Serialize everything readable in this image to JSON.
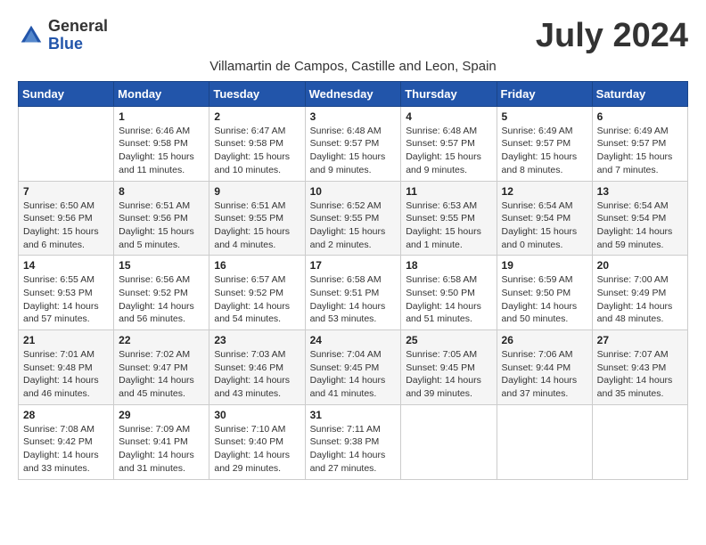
{
  "logo": {
    "general": "General",
    "blue": "Blue"
  },
  "title": "July 2024",
  "location": "Villamartin de Campos, Castille and Leon, Spain",
  "headers": [
    "Sunday",
    "Monday",
    "Tuesday",
    "Wednesday",
    "Thursday",
    "Friday",
    "Saturday"
  ],
  "weeks": [
    [
      null,
      {
        "day": "1",
        "sunrise": "6:46 AM",
        "sunset": "9:58 PM",
        "daylight": "15 hours and 11 minutes."
      },
      {
        "day": "2",
        "sunrise": "6:47 AM",
        "sunset": "9:58 PM",
        "daylight": "15 hours and 10 minutes."
      },
      {
        "day": "3",
        "sunrise": "6:48 AM",
        "sunset": "9:57 PM",
        "daylight": "15 hours and 9 minutes."
      },
      {
        "day": "4",
        "sunrise": "6:48 AM",
        "sunset": "9:57 PM",
        "daylight": "15 hours and 9 minutes."
      },
      {
        "day": "5",
        "sunrise": "6:49 AM",
        "sunset": "9:57 PM",
        "daylight": "15 hours and 8 minutes."
      },
      {
        "day": "6",
        "sunrise": "6:49 AM",
        "sunset": "9:57 PM",
        "daylight": "15 hours and 7 minutes."
      }
    ],
    [
      {
        "day": "7",
        "sunrise": "6:50 AM",
        "sunset": "9:56 PM",
        "daylight": "15 hours and 6 minutes."
      },
      {
        "day": "8",
        "sunrise": "6:51 AM",
        "sunset": "9:56 PM",
        "daylight": "15 hours and 5 minutes."
      },
      {
        "day": "9",
        "sunrise": "6:51 AM",
        "sunset": "9:55 PM",
        "daylight": "15 hours and 4 minutes."
      },
      {
        "day": "10",
        "sunrise": "6:52 AM",
        "sunset": "9:55 PM",
        "daylight": "15 hours and 2 minutes."
      },
      {
        "day": "11",
        "sunrise": "6:53 AM",
        "sunset": "9:55 PM",
        "daylight": "15 hours and 1 minute."
      },
      {
        "day": "12",
        "sunrise": "6:54 AM",
        "sunset": "9:54 PM",
        "daylight": "15 hours and 0 minutes."
      },
      {
        "day": "13",
        "sunrise": "6:54 AM",
        "sunset": "9:54 PM",
        "daylight": "14 hours and 59 minutes."
      }
    ],
    [
      {
        "day": "14",
        "sunrise": "6:55 AM",
        "sunset": "9:53 PM",
        "daylight": "14 hours and 57 minutes."
      },
      {
        "day": "15",
        "sunrise": "6:56 AM",
        "sunset": "9:52 PM",
        "daylight": "14 hours and 56 minutes."
      },
      {
        "day": "16",
        "sunrise": "6:57 AM",
        "sunset": "9:52 PM",
        "daylight": "14 hours and 54 minutes."
      },
      {
        "day": "17",
        "sunrise": "6:58 AM",
        "sunset": "9:51 PM",
        "daylight": "14 hours and 53 minutes."
      },
      {
        "day": "18",
        "sunrise": "6:58 AM",
        "sunset": "9:50 PM",
        "daylight": "14 hours and 51 minutes."
      },
      {
        "day": "19",
        "sunrise": "6:59 AM",
        "sunset": "9:50 PM",
        "daylight": "14 hours and 50 minutes."
      },
      {
        "day": "20",
        "sunrise": "7:00 AM",
        "sunset": "9:49 PM",
        "daylight": "14 hours and 48 minutes."
      }
    ],
    [
      {
        "day": "21",
        "sunrise": "7:01 AM",
        "sunset": "9:48 PM",
        "daylight": "14 hours and 46 minutes."
      },
      {
        "day": "22",
        "sunrise": "7:02 AM",
        "sunset": "9:47 PM",
        "daylight": "14 hours and 45 minutes."
      },
      {
        "day": "23",
        "sunrise": "7:03 AM",
        "sunset": "9:46 PM",
        "daylight": "14 hours and 43 minutes."
      },
      {
        "day": "24",
        "sunrise": "7:04 AM",
        "sunset": "9:45 PM",
        "daylight": "14 hours and 41 minutes."
      },
      {
        "day": "25",
        "sunrise": "7:05 AM",
        "sunset": "9:45 PM",
        "daylight": "14 hours and 39 minutes."
      },
      {
        "day": "26",
        "sunrise": "7:06 AM",
        "sunset": "9:44 PM",
        "daylight": "14 hours and 37 minutes."
      },
      {
        "day": "27",
        "sunrise": "7:07 AM",
        "sunset": "9:43 PM",
        "daylight": "14 hours and 35 minutes."
      }
    ],
    [
      {
        "day": "28",
        "sunrise": "7:08 AM",
        "sunset": "9:42 PM",
        "daylight": "14 hours and 33 minutes."
      },
      {
        "day": "29",
        "sunrise": "7:09 AM",
        "sunset": "9:41 PM",
        "daylight": "14 hours and 31 minutes."
      },
      {
        "day": "30",
        "sunrise": "7:10 AM",
        "sunset": "9:40 PM",
        "daylight": "14 hours and 29 minutes."
      },
      {
        "day": "31",
        "sunrise": "7:11 AM",
        "sunset": "9:38 PM",
        "daylight": "14 hours and 27 minutes."
      },
      null,
      null,
      null
    ]
  ]
}
